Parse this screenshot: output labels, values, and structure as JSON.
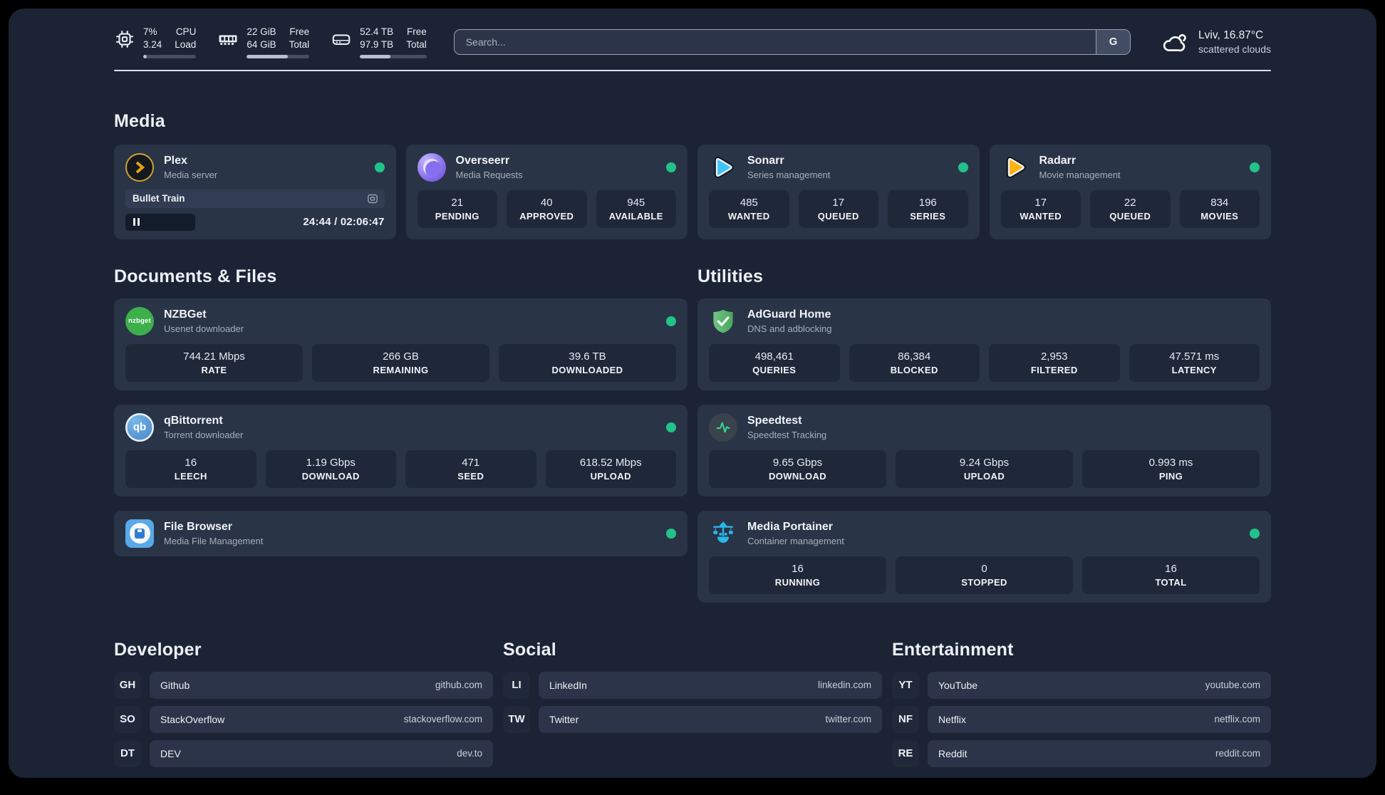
{
  "header": {
    "cpu": {
      "value_top": "7%",
      "value_bottom": "3.24",
      "label_top": "CPU",
      "label_bottom": "Load",
      "progress": 7
    },
    "ram": {
      "value_top": "22 GiB",
      "value_bottom": "64 GiB",
      "label_top": "Free",
      "label_bottom": "Total",
      "progress": 66
    },
    "disk": {
      "value_top": "52.4 TB",
      "value_bottom": "97.9 TB",
      "label_top": "Free",
      "label_bottom": "Total",
      "progress": 46
    },
    "search": {
      "placeholder": "Search...",
      "button": "G"
    },
    "weather": {
      "line1": "Lviv, 16.87°C",
      "line2": "scattered clouds"
    }
  },
  "sections": {
    "media": "Media",
    "documents": "Documents & Files",
    "utilities": "Utilities",
    "developer": "Developer",
    "social": "Social",
    "entertainment": "Entertainment"
  },
  "apps": {
    "plex": {
      "name": "Plex",
      "desc": "Media server",
      "media_title": "Bullet Train",
      "time": "24:44 / 02:06:47"
    },
    "overseerr": {
      "name": "Overseerr",
      "desc": "Media Requests",
      "stats": [
        {
          "value": "21",
          "label": "PENDING"
        },
        {
          "value": "40",
          "label": "APPROVED"
        },
        {
          "value": "945",
          "label": "AVAILABLE"
        }
      ]
    },
    "sonarr": {
      "name": "Sonarr",
      "desc": "Series management",
      "stats": [
        {
          "value": "485",
          "label": "WANTED"
        },
        {
          "value": "17",
          "label": "QUEUED"
        },
        {
          "value": "196",
          "label": "SERIES"
        }
      ]
    },
    "radarr": {
      "name": "Radarr",
      "desc": "Movie management",
      "stats": [
        {
          "value": "17",
          "label": "WANTED"
        },
        {
          "value": "22",
          "label": "QUEUED"
        },
        {
          "value": "834",
          "label": "MOVIES"
        }
      ]
    },
    "nzbget": {
      "name": "NZBGet",
      "desc": "Usenet downloader",
      "icon_text": "nzbget",
      "stats": [
        {
          "value": "744.21 Mbps",
          "label": "RATE"
        },
        {
          "value": "266 GB",
          "label": "REMAINING"
        },
        {
          "value": "39.6 TB",
          "label": "DOWNLOADED"
        }
      ]
    },
    "qbittorrent": {
      "name": "qBittorrent",
      "desc": "Torrent downloader",
      "icon_text": "qb",
      "stats": [
        {
          "value": "16",
          "label": "LEECH"
        },
        {
          "value": "1.19 Gbps",
          "label": "DOWNLOAD"
        },
        {
          "value": "471",
          "label": "SEED"
        },
        {
          "value": "618.52 Mbps",
          "label": "UPLOAD"
        }
      ]
    },
    "filebrowser": {
      "name": "File Browser",
      "desc": "Media File Management"
    },
    "adguard": {
      "name": "AdGuard Home",
      "desc": "DNS and adblocking",
      "stats": [
        {
          "value": "498,461",
          "label": "QUERIES"
        },
        {
          "value": "86,384",
          "label": "BLOCKED"
        },
        {
          "value": "2,953",
          "label": "FILTERED"
        },
        {
          "value": "47.571 ms",
          "label": "LATENCY"
        }
      ]
    },
    "speedtest": {
      "name": "Speedtest",
      "desc": "Speedtest Tracking",
      "stats": [
        {
          "value": "9.65 Gbps",
          "label": "DOWNLOAD"
        },
        {
          "value": "9.24 Gbps",
          "label": "UPLOAD"
        },
        {
          "value": "0.993 ms",
          "label": "PING"
        }
      ]
    },
    "portainer": {
      "name": "Media Portainer",
      "desc": "Container management",
      "stats": [
        {
          "value": "16",
          "label": "RUNNING"
        },
        {
          "value": "0",
          "label": "STOPPED"
        },
        {
          "value": "16",
          "label": "TOTAL"
        }
      ]
    }
  },
  "links": {
    "developer": [
      {
        "badge": "GH",
        "name": "Github",
        "url": "github.com"
      },
      {
        "badge": "SO",
        "name": "StackOverflow",
        "url": "stackoverflow.com"
      },
      {
        "badge": "DT",
        "name": "DEV",
        "url": "dev.to"
      }
    ],
    "social": [
      {
        "badge": "LI",
        "name": "LinkedIn",
        "url": "linkedin.com"
      },
      {
        "badge": "TW",
        "name": "Twitter",
        "url": "twitter.com"
      }
    ],
    "entertainment": [
      {
        "badge": "YT",
        "name": "YouTube",
        "url": "youtube.com"
      },
      {
        "badge": "NF",
        "name": "Netflix",
        "url": "netflix.com"
      },
      {
        "badge": "RE",
        "name": "Reddit",
        "url": "reddit.com"
      }
    ]
  },
  "colors": {
    "status_online": "#22c389",
    "plex_amber": "#e5a00d",
    "sonarr_blue": "#3fc3f7",
    "radarr_yellow": "#ffb310",
    "adguard_green": "#5cb268",
    "portainer_blue": "#29b9ea"
  }
}
